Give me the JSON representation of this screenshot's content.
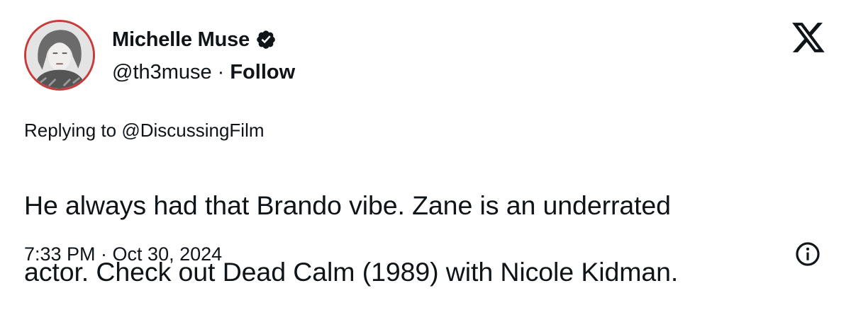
{
  "author": {
    "display_name": "Michelle Muse",
    "handle": "@th3muse",
    "separator": "·",
    "follow_label": "Follow",
    "verified": true
  },
  "icons": {
    "avatar": "user-photo",
    "verified": "verified-badge-icon",
    "brand": "x-logo-icon",
    "info": "info-icon"
  },
  "reply": {
    "prefix": "Replying to",
    "mention": "@DiscussingFilm"
  },
  "tweet": {
    "text_line_1": "He always had that Brando vibe. Zane is an underrated",
    "text_line_2": "actor. Check out Dead Calm (1989) with Nicole Kidman.",
    "timestamp": "7:33 PM · Oct 30, 2024"
  },
  "colors": {
    "text": "#0f1419",
    "avatar_border": "#c93a3a",
    "background": "#ffffff"
  }
}
